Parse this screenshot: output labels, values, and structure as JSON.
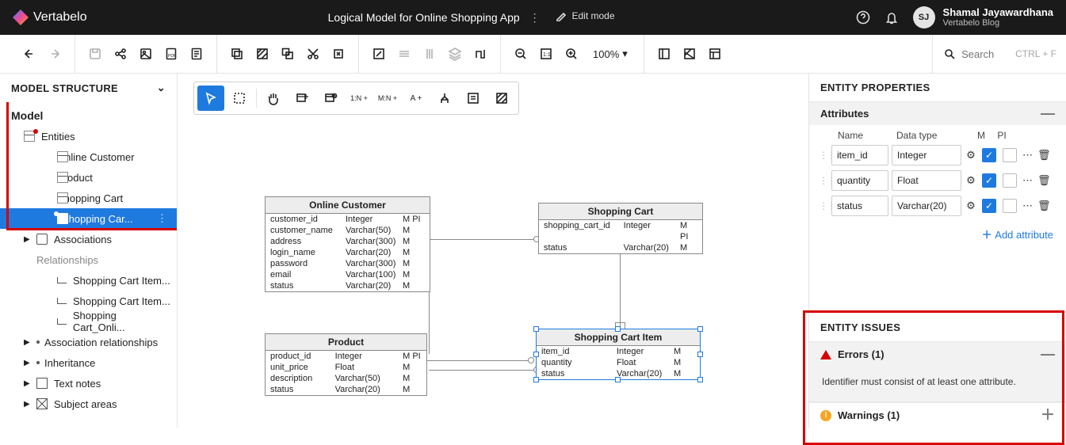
{
  "header": {
    "brand": "Vertabelo",
    "title": "Logical Model for Online Shopping App",
    "edit_mode": "Edit mode",
    "user_initials": "SJ",
    "user_name": "Shamal Jayawardhana",
    "user_org": "Vertabelo Blog"
  },
  "toolbar": {
    "zoom": "100%",
    "search_placeholder": "Search",
    "search_hint": "CTRL + F"
  },
  "sidebar": {
    "title": "MODEL STRUCTURE",
    "root": "Model",
    "entities_label": "Entities",
    "entities": [
      {
        "label": "Online Customer"
      },
      {
        "label": "Product"
      },
      {
        "label": "Shopping Cart"
      },
      {
        "label": "Shopping Car...",
        "selected": true
      }
    ],
    "associations_label": "Associations",
    "relationships_label": "Relationships",
    "relationships": [
      {
        "label": "Shopping Cart Item..."
      },
      {
        "label": "Shopping Cart Item..."
      },
      {
        "label": "Shopping Cart_Onli..."
      }
    ],
    "assoc_rel_label": "Association relationships",
    "inheritance_label": "Inheritance",
    "textnotes_label": "Text notes",
    "subjectareas_label": "Subject areas"
  },
  "canvas": {
    "entities": {
      "online_customer": {
        "title": "Online Customer",
        "rows": [
          {
            "name": "customer_id",
            "type": "Integer",
            "flags": "M PI"
          },
          {
            "name": "customer_name",
            "type": "Varchar(50)",
            "flags": "M"
          },
          {
            "name": "address",
            "type": "Varchar(300)",
            "flags": "M"
          },
          {
            "name": "login_name",
            "type": "Varchar(20)",
            "flags": "M"
          },
          {
            "name": "password",
            "type": "Varchar(300)",
            "flags": "M"
          },
          {
            "name": "email",
            "type": "Varchar(100)",
            "flags": "M"
          },
          {
            "name": "status",
            "type": "Varchar(20)",
            "flags": "M"
          }
        ]
      },
      "shopping_cart": {
        "title": "Shopping Cart",
        "rows": [
          {
            "name": "shopping_cart_id",
            "type": "Integer",
            "flags": "M PI"
          },
          {
            "name": "status",
            "type": "Varchar(20)",
            "flags": "M"
          }
        ]
      },
      "product": {
        "title": "Product",
        "rows": [
          {
            "name": "product_id",
            "type": "Integer",
            "flags": "M PI"
          },
          {
            "name": "unit_price",
            "type": "Float",
            "flags": "M"
          },
          {
            "name": "description",
            "type": "Varchar(50)",
            "flags": "M"
          },
          {
            "name": "status",
            "type": "Varchar(20)",
            "flags": "M"
          }
        ]
      },
      "shopping_cart_item": {
        "title": "Shopping Cart Item",
        "rows": [
          {
            "name": "item_id",
            "type": "Integer",
            "flags": "M"
          },
          {
            "name": "quantity",
            "type": "Float",
            "flags": "M"
          },
          {
            "name": "status",
            "type": "Varchar(20)",
            "flags": "M"
          }
        ]
      }
    }
  },
  "rightpanel": {
    "title": "ENTITY PROPERTIES",
    "attributes_label": "Attributes",
    "cols": {
      "name": "Name",
      "type": "Data type",
      "m": "M",
      "pi": "PI"
    },
    "attrs": [
      {
        "name": "item_id",
        "type": "Integer",
        "m": true,
        "pi": false
      },
      {
        "name": "quantity",
        "type": "Float",
        "m": true,
        "pi": false
      },
      {
        "name": "status",
        "type": "Varchar(20)",
        "m": true,
        "pi": false
      }
    ],
    "add_attr": "Add attribute",
    "issues_title": "ENTITY ISSUES",
    "errors_label": "Errors (1)",
    "error_msg": "Identifier must consist of at least one attribute.",
    "warnings_label": "Warnings (1)"
  }
}
